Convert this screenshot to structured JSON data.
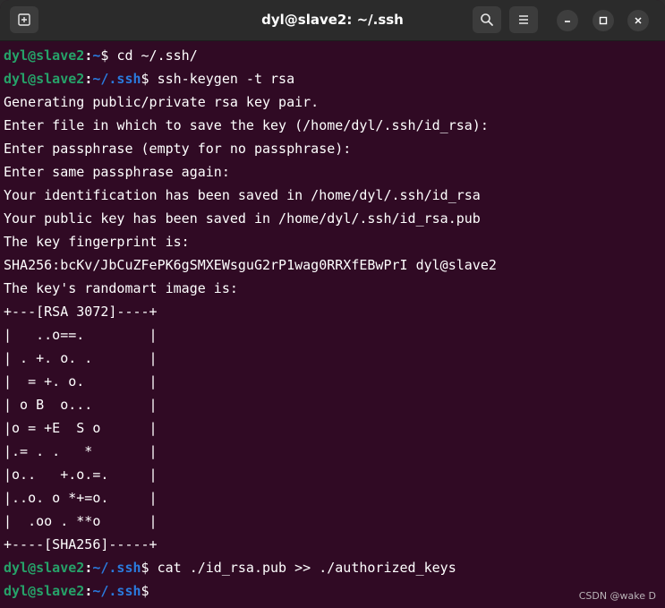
{
  "window": {
    "title": "dyl@slave2: ~/.ssh"
  },
  "icons": {
    "new_tab": "new-tab-icon",
    "search": "search-icon",
    "menu": "hamburger-menu-icon",
    "minimize": "minimize-icon",
    "maximize": "maximize-icon",
    "close": "close-icon"
  },
  "colors": {
    "terminal_background": "#300a24",
    "prompt_user": "#26a269",
    "prompt_path": "#2a7bde",
    "titlebar": "#2b2b2b"
  },
  "terminal": {
    "prompt_user": "dyl@slave2",
    "prompt_colon": ":",
    "lines": [
      {
        "type": "prompt",
        "path": "~",
        "dollar": "$ ",
        "command": "cd ~/.ssh/"
      },
      {
        "type": "prompt",
        "path": "~/.ssh",
        "dollar": "$ ",
        "command": "ssh-keygen -t rsa"
      },
      {
        "type": "output",
        "text": "Generating public/private rsa key pair."
      },
      {
        "type": "output",
        "text": "Enter file in which to save the key (/home/dyl/.ssh/id_rsa):"
      },
      {
        "type": "output",
        "text": "Enter passphrase (empty for no passphrase):"
      },
      {
        "type": "output",
        "text": "Enter same passphrase again:"
      },
      {
        "type": "output",
        "text": "Your identification has been saved in /home/dyl/.ssh/id_rsa"
      },
      {
        "type": "output",
        "text": "Your public key has been saved in /home/dyl/.ssh/id_rsa.pub"
      },
      {
        "type": "output",
        "text": "The key fingerprint is:"
      },
      {
        "type": "output",
        "text": "SHA256:bcKv/JbCuZFePK6gSMXEWsguG2rP1wag0RRXfEBwPrI dyl@slave2"
      },
      {
        "type": "output",
        "text": "The key's randomart image is:"
      },
      {
        "type": "output",
        "text": "+---[RSA 3072]----+"
      },
      {
        "type": "output",
        "text": "|   ..o==.        |"
      },
      {
        "type": "output",
        "text": "| . +. o. .       |"
      },
      {
        "type": "output",
        "text": "|  = +. o.        |"
      },
      {
        "type": "output",
        "text": "| o B  o...       |"
      },
      {
        "type": "output",
        "text": "|o = +E  S o      |"
      },
      {
        "type": "output",
        "text": "|.= . .   *       |"
      },
      {
        "type": "output",
        "text": "|o..   +.o.=.     |"
      },
      {
        "type": "output",
        "text": "|..o. o *+=o.     |"
      },
      {
        "type": "output",
        "text": "|  .oo . **o      |"
      },
      {
        "type": "output",
        "text": "+----[SHA256]-----+"
      },
      {
        "type": "prompt",
        "path": "~/.ssh",
        "dollar": "$ ",
        "command": "cat ./id_rsa.pub >> ./authorized_keys"
      },
      {
        "type": "prompt",
        "path": "~/.ssh",
        "dollar": "$",
        "command": ""
      }
    ]
  },
  "watermark": "CSDN @wake D"
}
